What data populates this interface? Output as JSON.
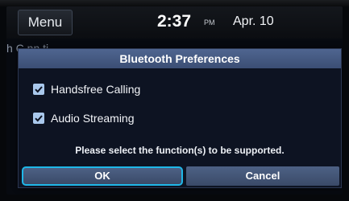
{
  "statusbar": {
    "menu_label": "Menu",
    "time": "2:37",
    "ampm": "PM",
    "date": "Apr. 10"
  },
  "background": {
    "partial_text": "h C  nn  ti"
  },
  "dialog": {
    "title": "Bluetooth Preferences",
    "options": [
      {
        "label": "Handsfree Calling",
        "checked": true
      },
      {
        "label": "Audio Streaming",
        "checked": true
      }
    ],
    "message": "Please select the function(s) to be supported.",
    "ok_label": "OK",
    "cancel_label": "Cancel"
  },
  "colors": {
    "title_bar": "#4f6590",
    "dialog_bg": "#0d1322",
    "focus_ring": "#1fb7e8",
    "checkbox": "#a9c8ec"
  },
  "icons": {
    "checkbox_checked": "check-icon"
  }
}
